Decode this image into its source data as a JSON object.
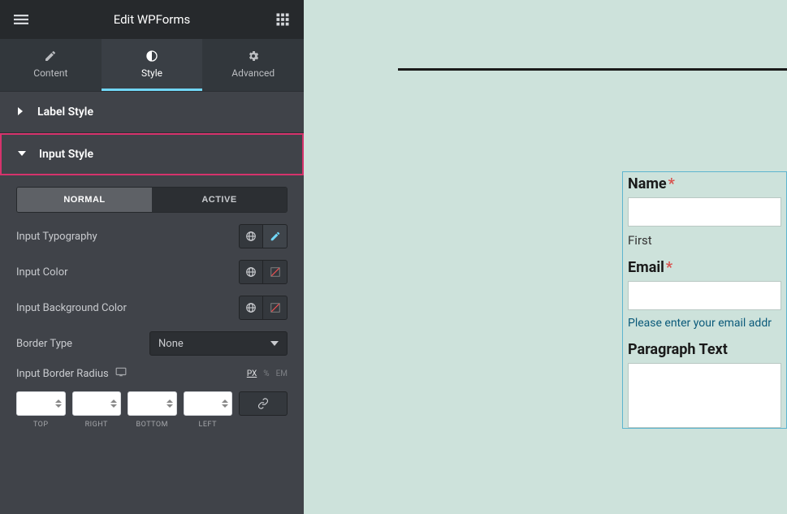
{
  "header": {
    "title": "Edit WPForms"
  },
  "tabs": {
    "content": "Content",
    "style": "Style",
    "advanced": "Advanced",
    "active": "style"
  },
  "sections": {
    "label_style": "Label Style",
    "input_style": "Input Style"
  },
  "input_style": {
    "state_normal": "NORMAL",
    "state_active": "ACTIVE",
    "typography_label": "Input Typography",
    "color_label": "Input Color",
    "bg_color_label": "Input Background Color",
    "border_type_label": "Border Type",
    "border_type_value": "None",
    "border_radius_label": "Input Border Radius",
    "units": {
      "px": "PX",
      "pct": "%",
      "em": "EM"
    },
    "dims": {
      "top": "TOP",
      "right": "RIGHT",
      "bottom": "BOTTOM",
      "left": "LEFT"
    }
  },
  "preview": {
    "name_label": "Name",
    "first_label": "First",
    "email_label": "Email",
    "email_hint": "Please enter your email addr",
    "paragraph_label": "Paragraph Text"
  }
}
